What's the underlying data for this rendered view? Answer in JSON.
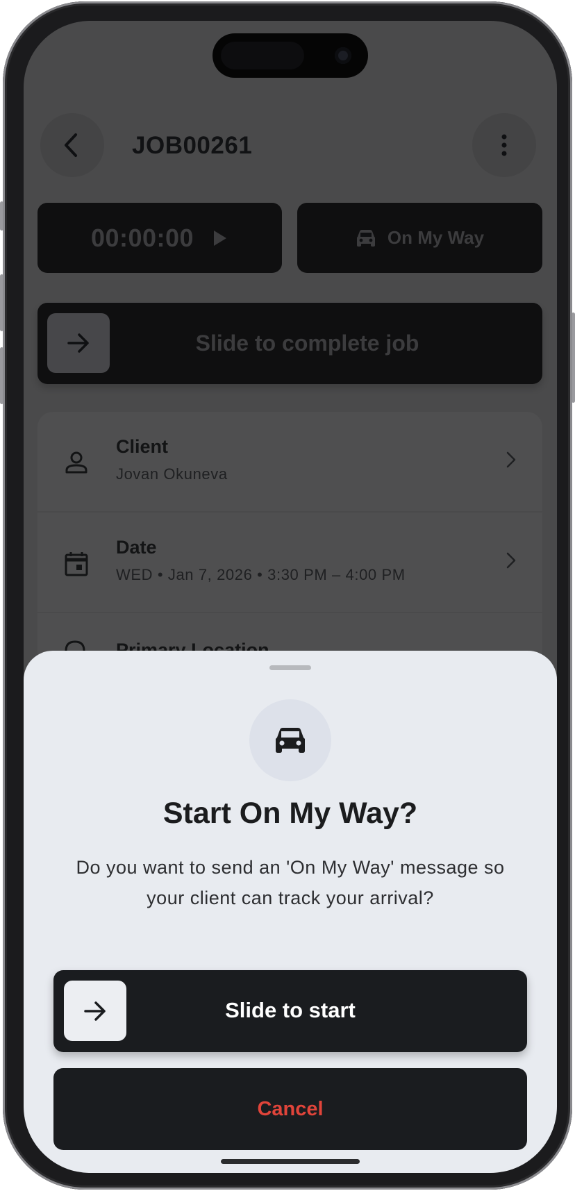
{
  "header": {
    "title": "JOB00261",
    "back_icon": "chevron-left-icon",
    "menu_icon": "more-vertical-icon"
  },
  "timer": {
    "value": "00:00:00",
    "icon": "play-icon"
  },
  "on_my_way_button": {
    "label": "On My Way",
    "icon": "car-icon"
  },
  "complete_slider": {
    "label": "Slide to complete job",
    "icon": "arrow-right-icon"
  },
  "details": [
    {
      "title": "Client",
      "subtitle": "Jovan Okuneva",
      "icon": "person-icon"
    },
    {
      "title": "Date",
      "subtitle": "WED • Jan 7, 2026 • 3:30 PM – 4:00 PM",
      "icon": "calendar-icon"
    },
    {
      "title": "Primary Location",
      "icon": "location-icon"
    }
  ],
  "sheet": {
    "icon": "car-icon",
    "title": "Start On My Way?",
    "message": "Do you want to send an 'On My Way' message so your client can track your arrival?",
    "slide_label": "Slide to start",
    "cancel_label": "Cancel"
  },
  "colors": {
    "overlay": "#4a4a4b",
    "sheet_bg": "#e8ebf0",
    "button_dark": "#1a1c1f",
    "cancel_red": "#e0443a"
  }
}
